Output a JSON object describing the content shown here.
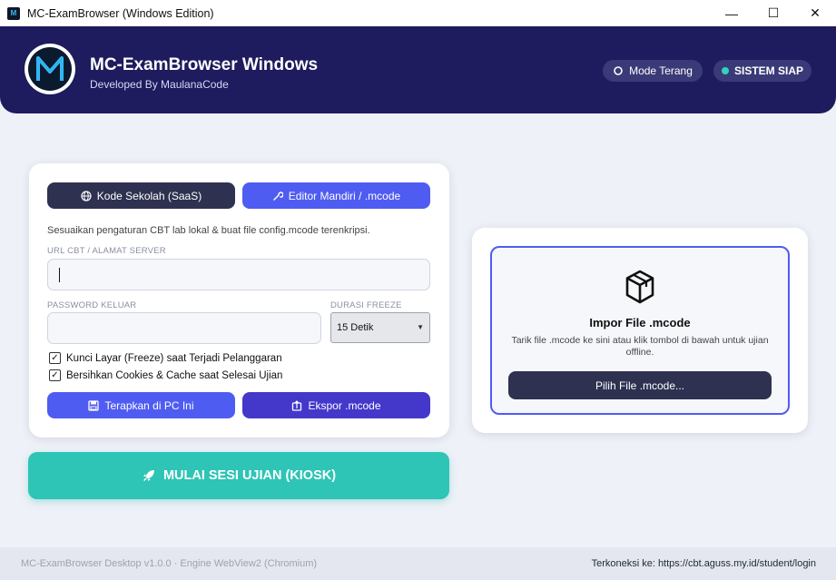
{
  "window": {
    "title": "MC-ExamBrowser (Windows Edition)",
    "controls": {
      "minimize": "—",
      "maximize": "☐",
      "close": "✕"
    }
  },
  "header": {
    "title": "MC-ExamBrowser Windows",
    "subtitle": "Developed By MaulanaCode",
    "logo_letter": "M",
    "mode_button": "Mode Terang",
    "status_badge": "SISTEM SIAP"
  },
  "config_card": {
    "tab_school": "Kode Sekolah (SaaS)",
    "tab_editor": "Editor Mandiri / .mcode",
    "description": "Sesuaikan pengaturan CBT lab lokal & buat file config.mcode terenkripsi.",
    "url_label": "URL CBT / ALAMAT SERVER",
    "url_value": "",
    "password_label": "PASSWORD KELUAR",
    "password_value": "",
    "freeze_label": "DURASI FREEZE",
    "freeze_value": "15 Detik",
    "check_lock": {
      "label": "Kunci Layar (Freeze) saat Terjadi Pelanggaran",
      "checked": true
    },
    "check_clean": {
      "label": "Bersihkan Cookies & Cache saat Selesai Ujian",
      "checked": true
    },
    "apply_button": "Terapkan di PC Ini",
    "export_button": "Ekspor .mcode"
  },
  "start_button": "MULAI SESI UJIAN (KIOSK)",
  "import_card": {
    "title": "Impor File .mcode",
    "description": "Tarik file .mcode ke sini atau klik tombol di bawah untuk ujian offline.",
    "button": "Pilih File .mcode..."
  },
  "footer": {
    "version": "MC-ExamBrowser Desktop v1.0.0 · Engine WebView2 (Chromium)",
    "connection": "Terkoneksi ke: https://cbt.aguss.my.id/student/login"
  },
  "colors": {
    "header_bg": "#1e1b5e",
    "accent_blue": "#4f5cf2",
    "accent_indigo": "#4338ca",
    "dark_button": "#2e3250",
    "start_teal": "#2ec4b6",
    "status_dot": "#2dd4bf"
  },
  "icons": {
    "mode": "sun-icon",
    "school_tab": "globe-icon",
    "editor_tab": "wrench-icon",
    "apply": "save-icon",
    "export": "export-icon",
    "start": "rocket-icon",
    "import": "box-icon"
  }
}
